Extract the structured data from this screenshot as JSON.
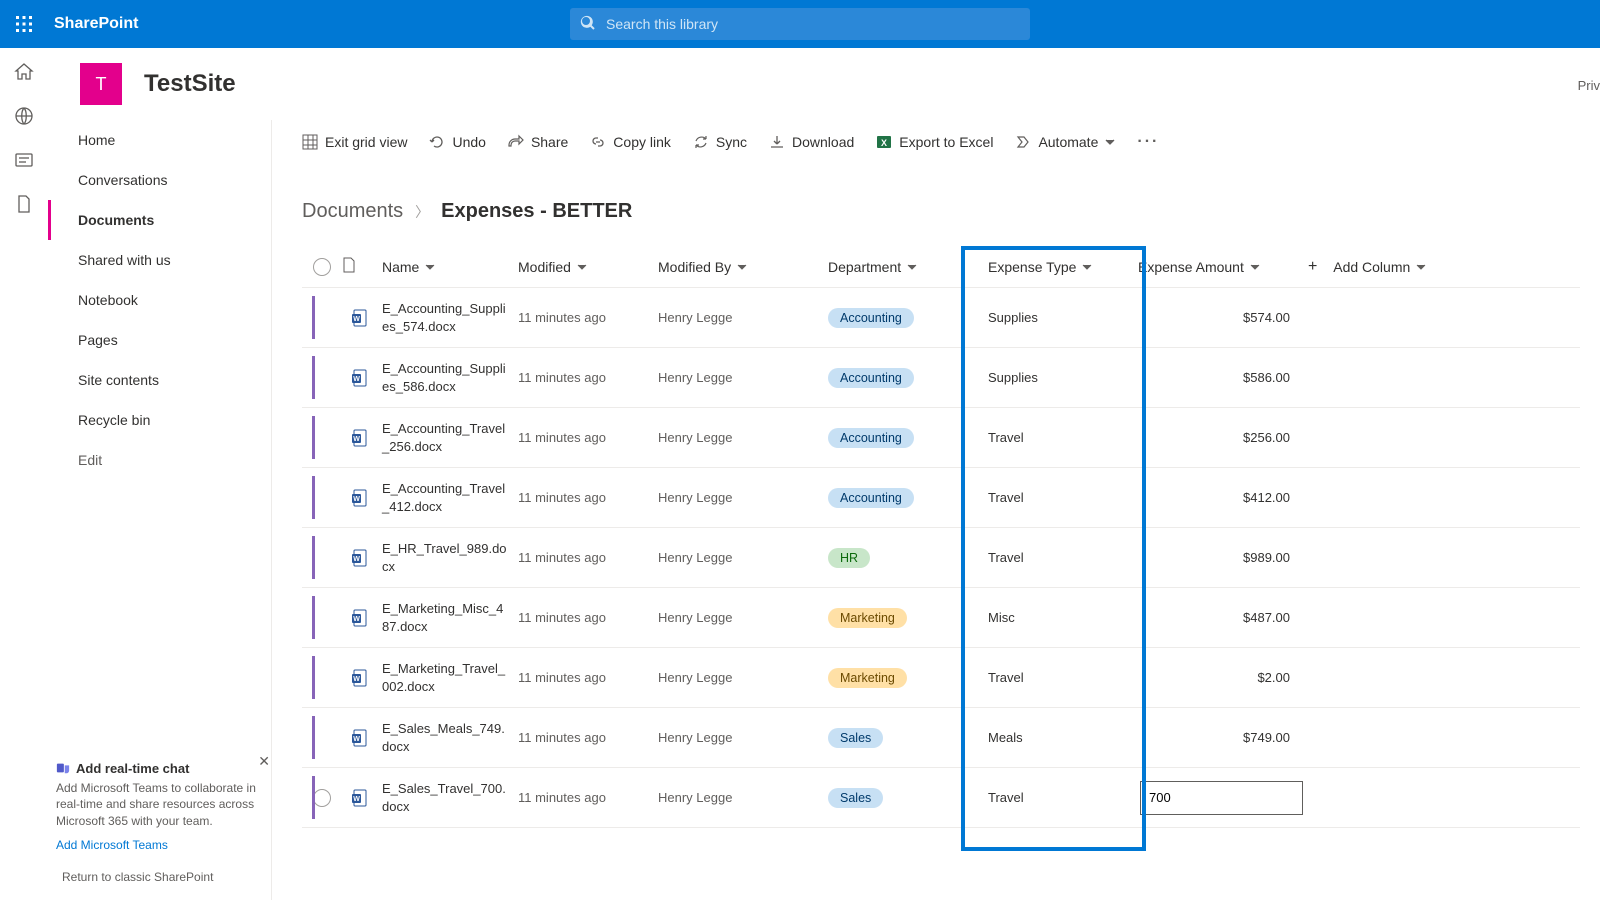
{
  "brand": "SharePoint",
  "search": {
    "placeholder": "Search this library"
  },
  "site": {
    "initial": "T",
    "name": "TestSite",
    "privacy": "Priv"
  },
  "nav": {
    "items": [
      "Home",
      "Conversations",
      "Documents",
      "Shared with us",
      "Notebook",
      "Pages",
      "Site contents",
      "Recycle bin"
    ],
    "edit": "Edit"
  },
  "promo": {
    "title": "Add real-time chat",
    "desc": "Add Microsoft Teams to collaborate in real-time and share resources across Microsoft 365 with your team.",
    "link": "Add Microsoft Teams"
  },
  "classic": "Return to classic SharePoint",
  "cmd": {
    "exit": "Exit grid view",
    "undo": "Undo",
    "share": "Share",
    "copy": "Copy link",
    "sync": "Sync",
    "download": "Download",
    "excel": "Export to Excel",
    "automate": "Automate"
  },
  "crumb": {
    "root": "Documents",
    "current": "Expenses - BETTER"
  },
  "cols": {
    "name": "Name",
    "modified": "Modified",
    "modifiedBy": "Modified By",
    "department": "Department",
    "expenseType": "Expense Type",
    "expenseAmount": "Expense Amount",
    "add": "Add Column"
  },
  "rows": [
    {
      "name": "E_Accounting_Supplies_574.docx",
      "mod": "11 minutes ago",
      "by": "Henry Legge",
      "dept": "Accounting",
      "deptClass": "acct",
      "type": "Supplies",
      "amt": "$574.00"
    },
    {
      "name": "E_Accounting_Supplies_586.docx",
      "mod": "11 minutes ago",
      "by": "Henry Legge",
      "dept": "Accounting",
      "deptClass": "acct",
      "type": "Supplies",
      "amt": "$586.00"
    },
    {
      "name": "E_Accounting_Travel_256.docx",
      "mod": "11 minutes ago",
      "by": "Henry Legge",
      "dept": "Accounting",
      "deptClass": "acct",
      "type": "Travel",
      "amt": "$256.00"
    },
    {
      "name": "E_Accounting_Travel_412.docx",
      "mod": "11 minutes ago",
      "by": "Henry Legge",
      "dept": "Accounting",
      "deptClass": "acct",
      "type": "Travel",
      "amt": "$412.00"
    },
    {
      "name": "E_HR_Travel_989.docx",
      "mod": "11 minutes ago",
      "by": "Henry Legge",
      "dept": "HR",
      "deptClass": "hr",
      "type": "Travel",
      "amt": "$989.00"
    },
    {
      "name": "E_Marketing_Misc_487.docx",
      "mod": "11 minutes ago",
      "by": "Henry Legge",
      "dept": "Marketing",
      "deptClass": "mkt",
      "type": "Misc",
      "amt": "$487.00"
    },
    {
      "name": "E_Marketing_Travel_002.docx",
      "mod": "11 minutes ago",
      "by": "Henry Legge",
      "dept": "Marketing",
      "deptClass": "mkt",
      "type": "Travel",
      "amt": "$2.00"
    },
    {
      "name": "E_Sales_Meals_749.docx",
      "mod": "11 minutes ago",
      "by": "Henry Legge",
      "dept": "Sales",
      "deptClass": "sales",
      "type": "Meals",
      "amt": "$749.00"
    },
    {
      "name": "E_Sales_Travel_700.docx",
      "mod": "11 minutes ago",
      "by": "Henry Legge",
      "dept": "Sales",
      "deptClass": "sales",
      "type": "Travel",
      "amt": "",
      "editing": true,
      "editValue": "700"
    }
  ]
}
